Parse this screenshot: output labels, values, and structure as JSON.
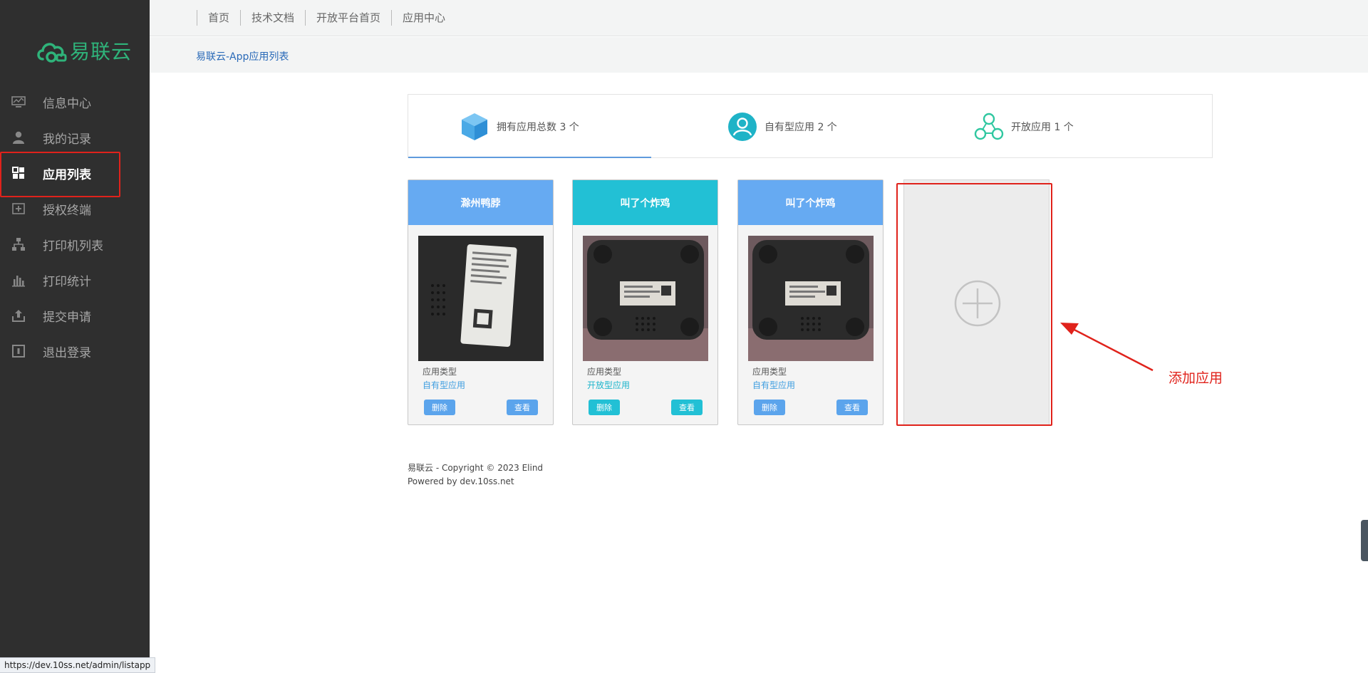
{
  "brand": {
    "name": "易联云",
    "color": "#2fb37a"
  },
  "sidebar": {
    "items": [
      {
        "label": "信息中心",
        "icon": "monitor-icon",
        "active": false
      },
      {
        "label": "我的记录",
        "icon": "user-icon",
        "active": false
      },
      {
        "label": "应用列表",
        "icon": "grid-icon",
        "active": true
      },
      {
        "label": "授权终端",
        "icon": "plus-box-icon",
        "active": false
      },
      {
        "label": "打印机列表",
        "icon": "network-icon",
        "active": false
      },
      {
        "label": "打印统计",
        "icon": "bar-chart-icon",
        "active": false
      },
      {
        "label": "提交申请",
        "icon": "upload-icon",
        "active": false
      },
      {
        "label": "退出登录",
        "icon": "logout-icon",
        "active": false
      }
    ]
  },
  "topnav": [
    "首页",
    "技术文档",
    "开放平台首页",
    "应用中心"
  ],
  "breadcrumb": "易联云-App应用列表",
  "stats": {
    "total": "拥有应用总数 3 个",
    "own": "自有型应用 2 个",
    "open": "开放应用 1 个"
  },
  "cards": [
    {
      "title": "滁州鸭脖",
      "color": "#66aaf2",
      "type_label": "应用类型",
      "type_value": "自有型应用",
      "type_color": "#3f9ee0",
      "delete": "删除",
      "view": "查看"
    },
    {
      "title": "叫了个炸鸡",
      "color": "#22c0d5",
      "type_label": "应用类型",
      "type_value": "开放型应用",
      "type_color": "#1db5cc",
      "delete": "删除",
      "view": "查看"
    },
    {
      "title": "叫了个炸鸡",
      "color": "#66aaf2",
      "type_label": "应用类型",
      "type_value": "自有型应用",
      "type_color": "#3f9ee0",
      "delete": "删除",
      "view": "查看"
    }
  ],
  "annotation": "添加应用",
  "footer": {
    "line1": "易联云 - Copyright © 2023 Elind",
    "line2": "Powered by dev.10ss.net"
  },
  "status_url": "https://dev.10ss.net/admin/listapp"
}
